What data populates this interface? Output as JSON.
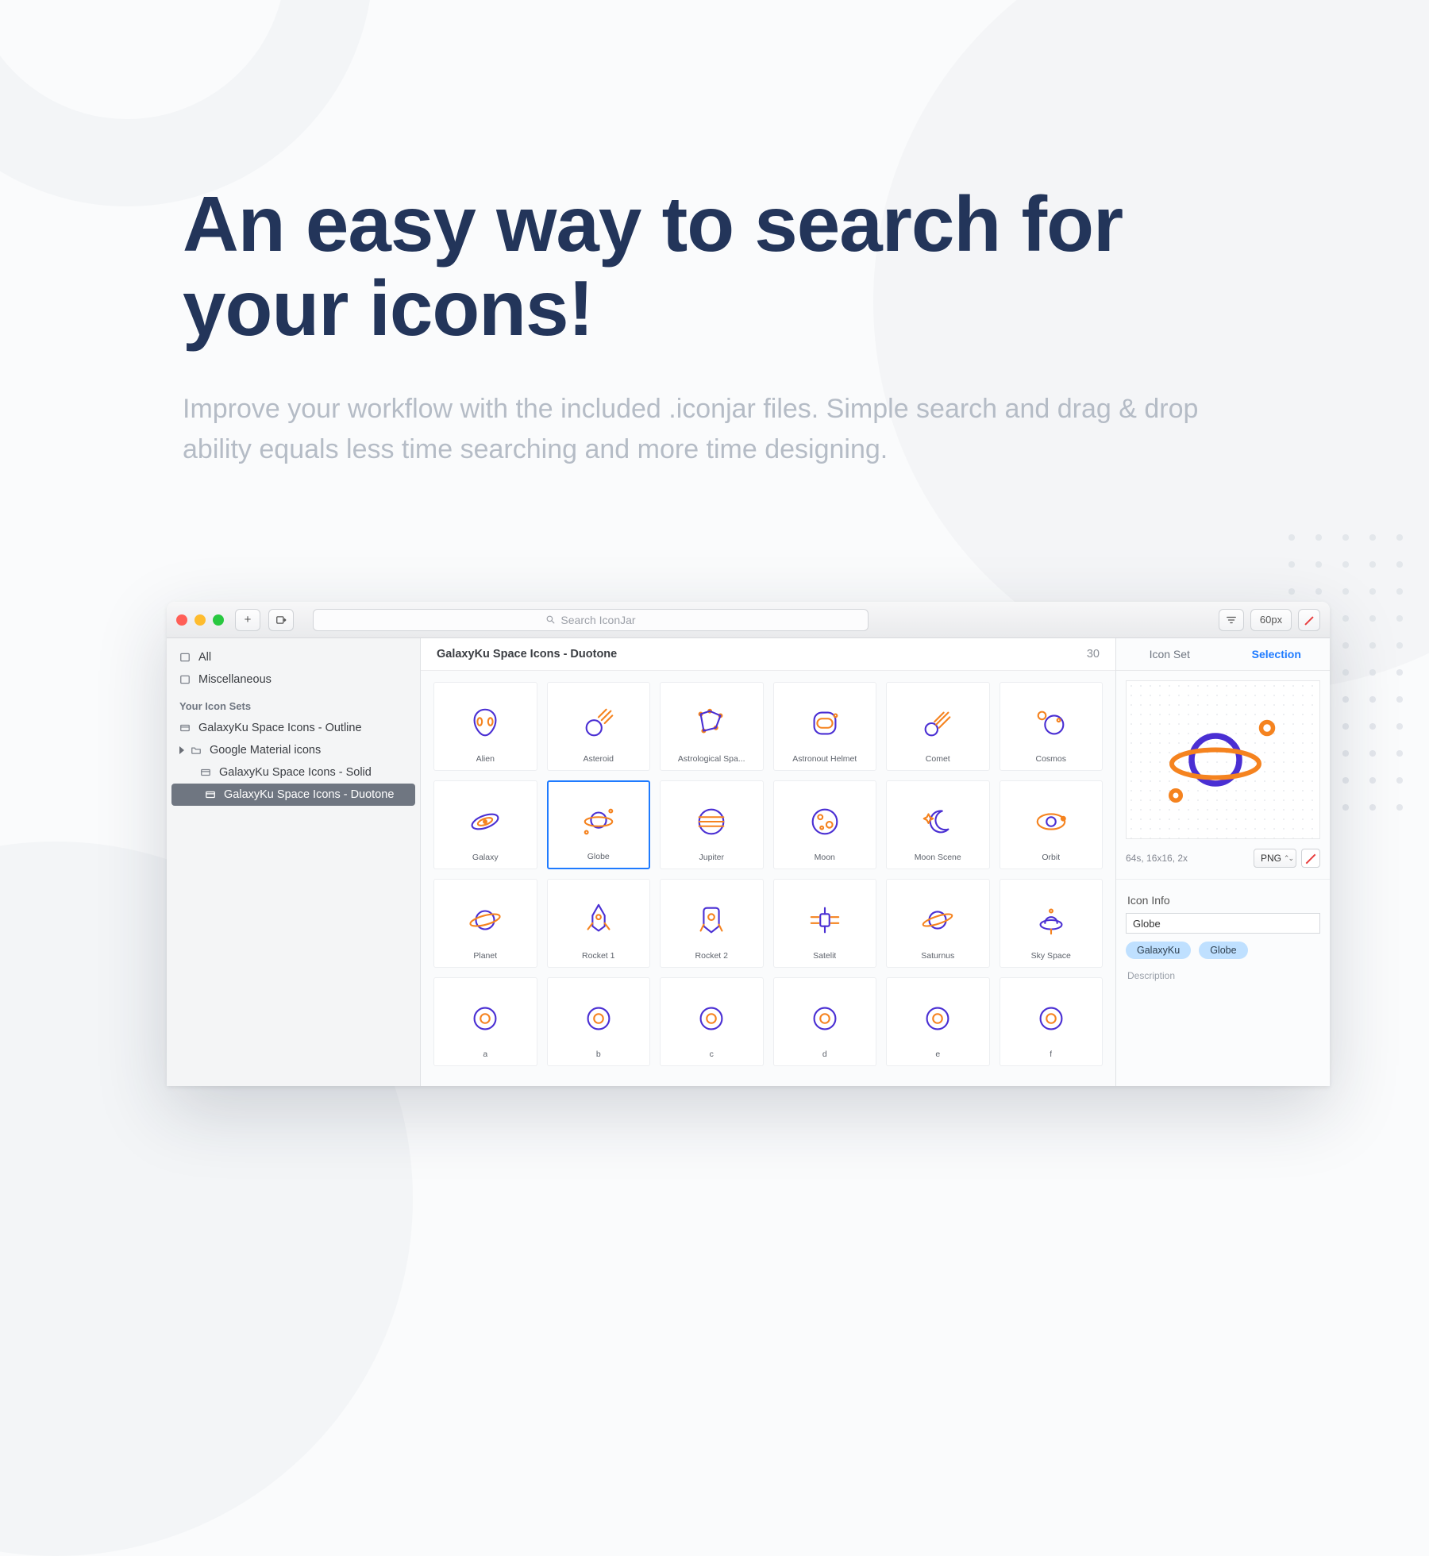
{
  "hero": {
    "title": "An easy way to search for your icons!",
    "subtitle": "Improve your workflow with the included .iconjar files. Simple search and drag & drop ability equals less time searching and more time designing."
  },
  "toolbar": {
    "search_placeholder": "Search IconJar",
    "size_label": "60px"
  },
  "sidebar": {
    "all": "All",
    "misc": "Miscellaneous",
    "header": "Your Icon Sets",
    "sets": [
      {
        "label": "GalaxyKu Space Icons - Outline",
        "child": false
      },
      {
        "label": "Google Material icons",
        "child": false,
        "expandable": true
      },
      {
        "label": "GalaxyKu Space Icons - Solid",
        "child": true
      },
      {
        "label": "GalaxyKu Space Icons - Duotone",
        "child": true,
        "selected": true
      }
    ]
  },
  "main": {
    "title": "GalaxyKu Space Icons - Duotone",
    "count": "30",
    "icons": [
      "Alien",
      "Asteroid",
      "Astrological Spa...",
      "Astronout Helmet",
      "Comet",
      "Cosmos",
      "Galaxy",
      "Globe",
      "Jupiter",
      "Moon",
      "Moon Scene",
      "Orbit",
      "Planet",
      "Rocket 1",
      "Rocket 2",
      "Satelit",
      "Saturnus",
      "Sky Space",
      "a",
      "b",
      "c",
      "d",
      "e",
      "f"
    ],
    "selected_index": 7
  },
  "panel": {
    "tab1": "Icon Set",
    "tab2": "Selection",
    "export_info": "64s, 16x16, 2x",
    "export_format": "PNG",
    "info_header": "Icon Info",
    "icon_name": "Globe",
    "tags": [
      "GalaxyKu",
      "Globe"
    ],
    "desc_label": "Description"
  },
  "colors": {
    "violet": "#4a2fd3",
    "orange": "#f5831f",
    "accent": "#1f7bff"
  }
}
